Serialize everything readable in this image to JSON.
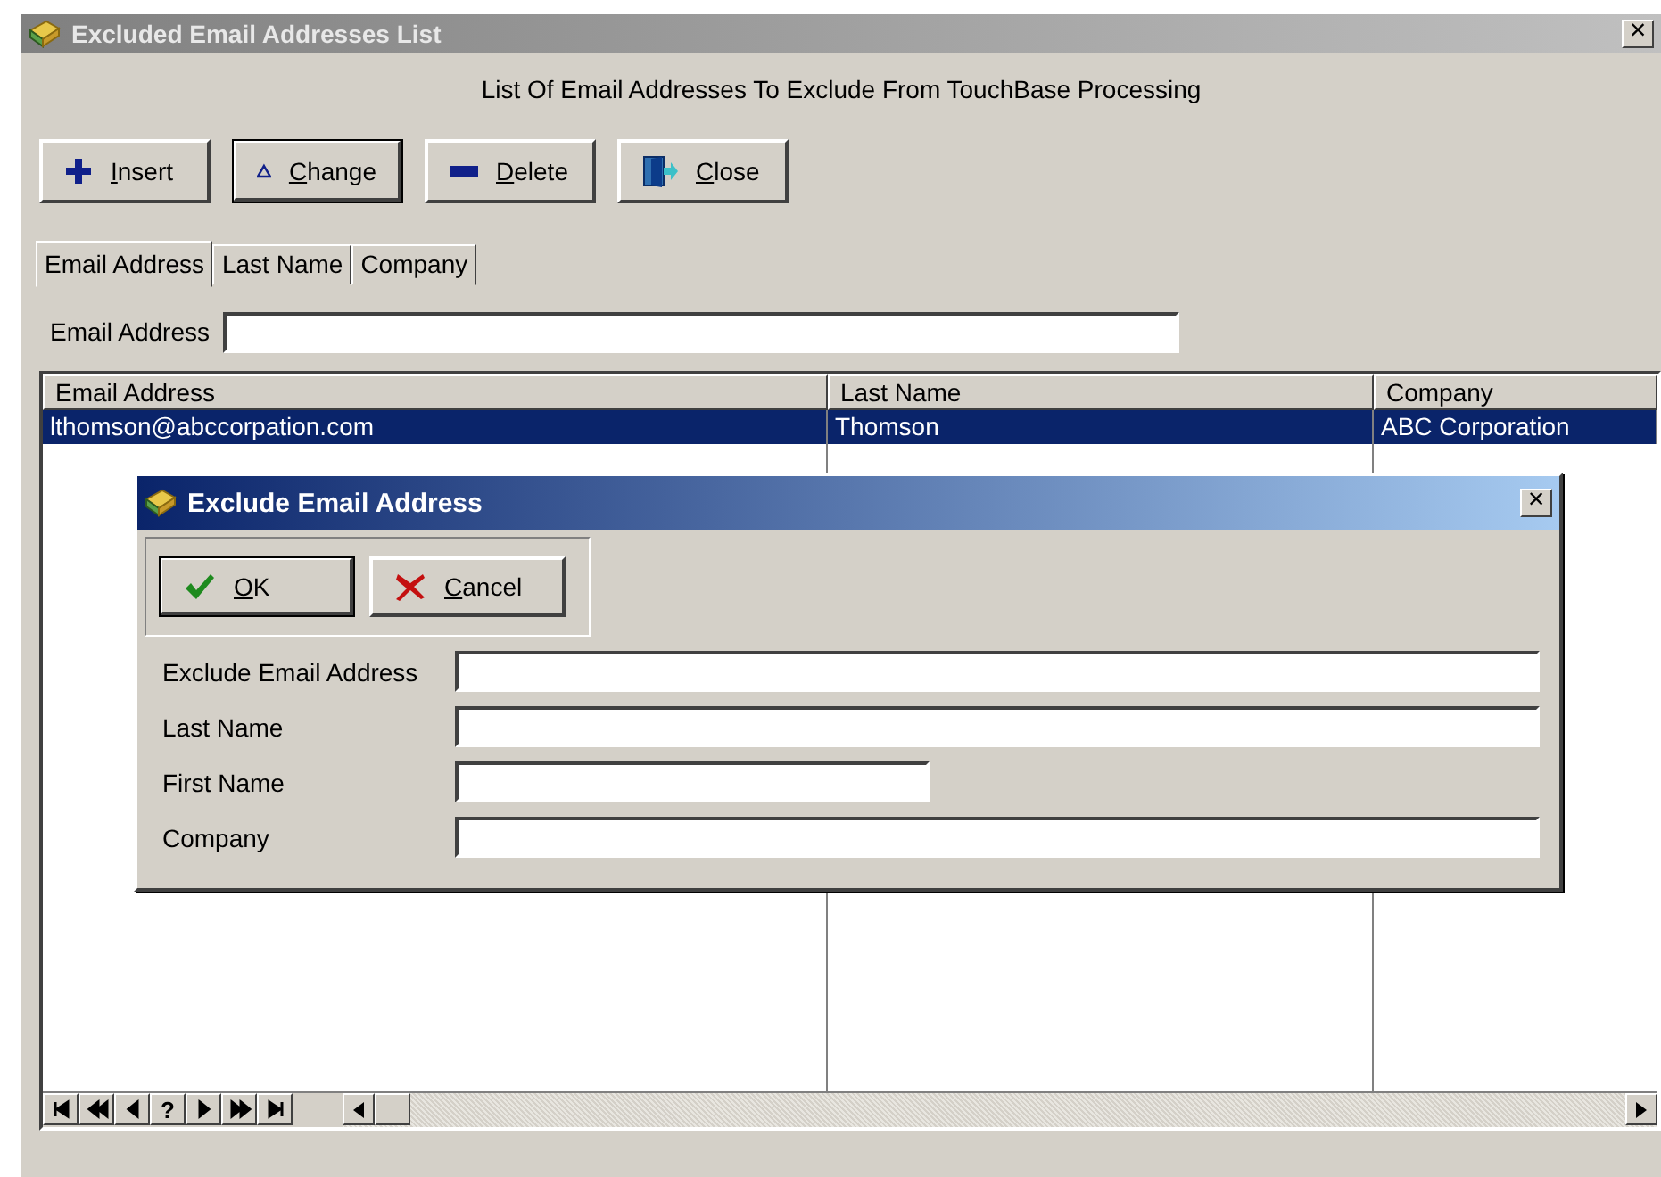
{
  "window": {
    "title": "Excluded Email Addresses List",
    "close": "×"
  },
  "heading": "List Of Email Addresses To Exclude From TouchBase Processing",
  "toolbar": [
    {
      "kind": "insert",
      "label": "Insert",
      "default": false
    },
    {
      "kind": "change",
      "label": "Change",
      "default": true
    },
    {
      "kind": "delete",
      "label": "Delete",
      "default": false
    },
    {
      "kind": "close",
      "label": "Close",
      "default": false
    }
  ],
  "tabs": [
    {
      "label": "Email Address",
      "selected": true
    },
    {
      "label": "Last Name",
      "selected": false
    },
    {
      "label": "Company",
      "selected": false
    }
  ],
  "search": {
    "label": "Email Address"
  },
  "table": {
    "columns": [
      "Email Address",
      "Last Name",
      "Company"
    ],
    "rows": [
      {
        "cells": [
          "lthomson@abccorpation.com",
          "Thomson",
          "ABC Corporation"
        ],
        "selected": true
      }
    ]
  },
  "navigator": [
    {
      "kind": "first"
    },
    {
      "kind": "prior-page"
    },
    {
      "kind": "prior"
    },
    {
      "kind": "text",
      "label": "?"
    },
    {
      "kind": "next"
    },
    {
      "kind": "next-page"
    },
    {
      "kind": "last"
    }
  ],
  "dialog": {
    "title": "Exclude Email Address",
    "close": "×",
    "buttons": [
      {
        "kind": "ok",
        "label": "OK",
        "default": true
      },
      {
        "kind": "cancel",
        "label": "Cancel",
        "default": false
      }
    ],
    "fields": [
      {
        "label": "Exclude Email Address",
        "kind": "long"
      },
      {
        "label": "Last Name",
        "kind": "long"
      },
      {
        "label": "First Name",
        "kind": "short"
      },
      {
        "label": "Company",
        "kind": "long"
      }
    ]
  }
}
